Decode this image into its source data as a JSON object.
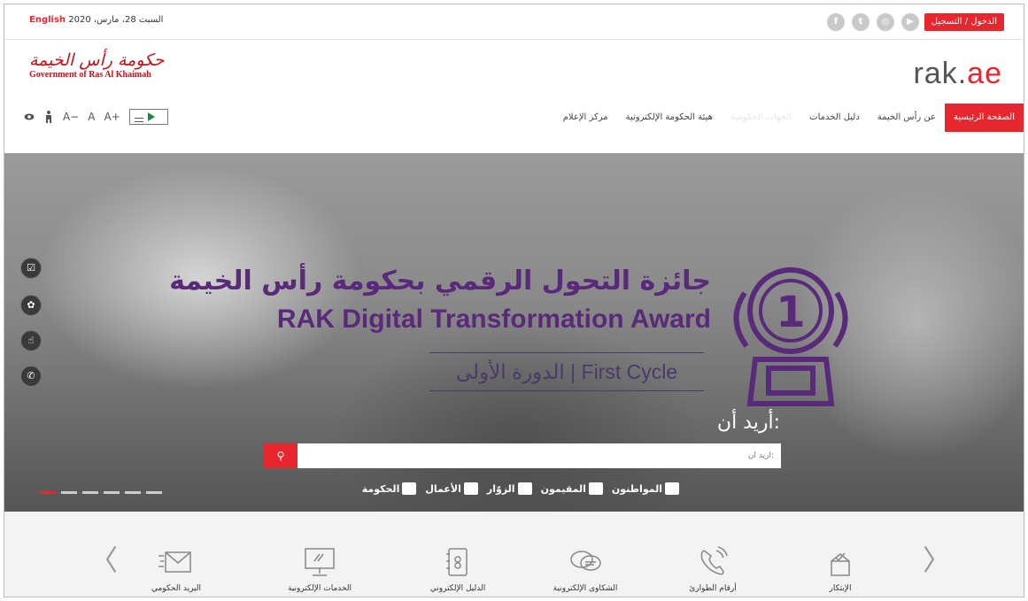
{
  "topbar": {
    "date": "السبت 28، مارس، 2020",
    "language": "English",
    "login": "الدخول / التسجيل",
    "social": [
      {
        "icon": "youtube-icon",
        "glyph": "▶"
      },
      {
        "icon": "instagram-icon",
        "glyph": "◎"
      },
      {
        "icon": "twitter-icon",
        "glyph": "t"
      },
      {
        "icon": "facebook-icon",
        "glyph": "f"
      }
    ]
  },
  "header": {
    "gov_ar": "حكومة رأس الخيمة",
    "gov_en": "Government of Ras Al Khaimah",
    "site_logo_main": "rak.",
    "site_logo_ae": "ae"
  },
  "nav": {
    "items": [
      {
        "label": "الصفحة الرئيسية",
        "state": "active"
      },
      {
        "label": "عن رأس الخيمة",
        "state": ""
      },
      {
        "label": "دليل الخدمات",
        "state": ""
      },
      {
        "label": "الجهات الحكومية",
        "state": "faded"
      },
      {
        "label": "هيئة الحكومة الإلكترونية",
        "state": ""
      },
      {
        "label": "مركز الإعلام",
        "state": ""
      }
    ],
    "tools": {
      "font_decrease": "A−",
      "font_normal": "A",
      "font_increase": "A+"
    }
  },
  "hero": {
    "award_ar": "جائزة التحول الرقمي بحكومة رأس الخيمة",
    "award_en": "RAK Digital Transformation Award",
    "cycle": "الدورة الأولى | First Cycle",
    "medal_number": "1",
    "want_label": "أريد أن:",
    "search_placeholder": "أريد أن:",
    "audiences": [
      {
        "label": "المواطنون",
        "icon": "citizens-icon"
      },
      {
        "label": "المقيمون",
        "icon": "residents-icon"
      },
      {
        "label": "الزوّار",
        "icon": "visitors-icon"
      },
      {
        "label": "الأعمال",
        "icon": "business-icon"
      },
      {
        "label": "الحكومة",
        "icon": "government-icon"
      }
    ],
    "slides_count": 6,
    "active_slide": 1
  },
  "services": {
    "items": [
      {
        "label": "الإبتكار",
        "icon": "innovation-icon"
      },
      {
        "label": "أرقام الطوارئ",
        "icon": "emergency-phone-icon"
      },
      {
        "label": "الشكاوى الإلكترونية",
        "icon": "complaints-icon"
      },
      {
        "label": "الدليل الإلكتروني",
        "icon": "directory-icon"
      },
      {
        "label": "الخدمات الإلكترونية",
        "icon": "eservices-icon"
      },
      {
        "label": "البريد الحكومي",
        "icon": "mail-icon"
      }
    ]
  },
  "colors": {
    "accent": "#e8262d",
    "award_purple": "#5a2a7a"
  }
}
